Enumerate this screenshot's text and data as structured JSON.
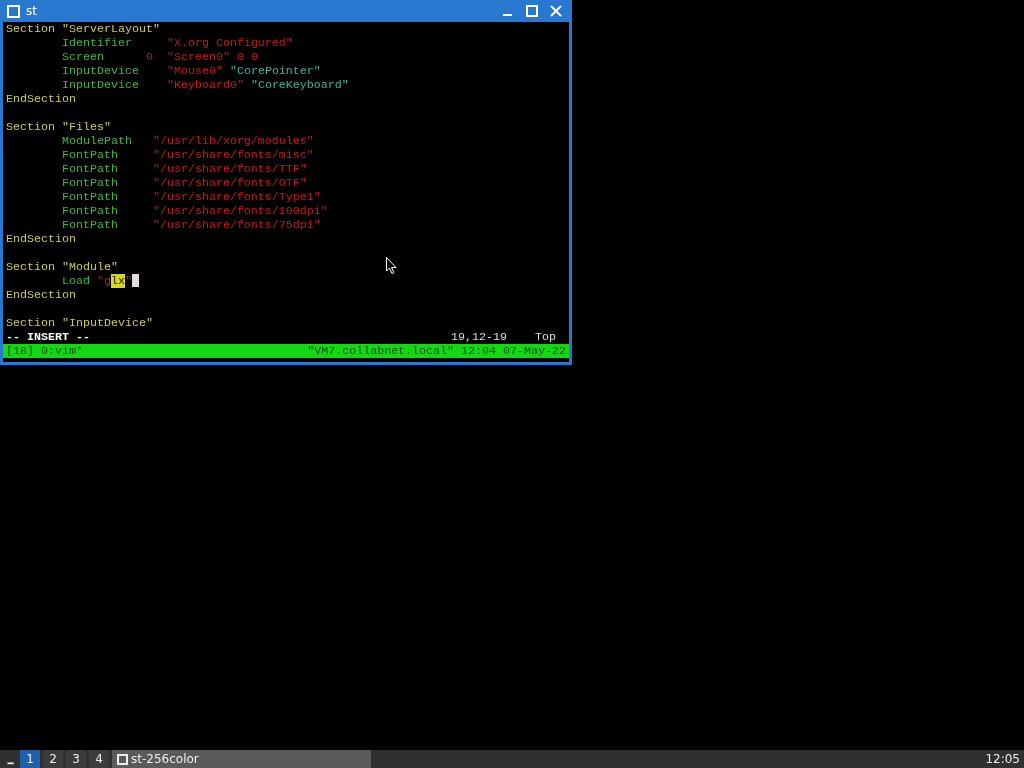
{
  "window": {
    "title": "st",
    "active": true
  },
  "terminal": {
    "lines": [
      {
        "kind": "code",
        "indented": false,
        "segments": [
          {
            "text": "Section ",
            "kind": "keyword"
          },
          {
            "text": "\"ServerLayout\"",
            "kind": "keyword"
          }
        ]
      },
      {
        "kind": "code",
        "indented": true,
        "segments": [
          {
            "text": "Identifier     ",
            "kind": "option"
          },
          {
            "text": "\"X.org Configured\"",
            "kind": "string"
          }
        ]
      },
      {
        "kind": "code",
        "indented": true,
        "segments": [
          {
            "text": "Screen      ",
            "kind": "option"
          },
          {
            "text": "0  ",
            "kind": "string"
          },
          {
            "text": "\"Screen0\" 0 0",
            "kind": "string"
          }
        ]
      },
      {
        "kind": "code",
        "indented": true,
        "segments": [
          {
            "text": "InputDevice    ",
            "kind": "option"
          },
          {
            "text": "\"Mouse0\" ",
            "kind": "string"
          },
          {
            "text": "\"CorePointer\"",
            "kind": "special"
          }
        ]
      },
      {
        "kind": "code",
        "indented": true,
        "segments": [
          {
            "text": "InputDevice    ",
            "kind": "option"
          },
          {
            "text": "\"Keyboard0\" ",
            "kind": "string"
          },
          {
            "text": "\"CoreKeyboard\"",
            "kind": "special"
          }
        ]
      },
      {
        "kind": "code",
        "indented": false,
        "segments": [
          {
            "text": "EndSection",
            "kind": "keyword"
          }
        ]
      },
      {
        "kind": "blank"
      },
      {
        "kind": "code",
        "indented": false,
        "segments": [
          {
            "text": "Section ",
            "kind": "keyword"
          },
          {
            "text": "\"Files\"",
            "kind": "keyword"
          }
        ]
      },
      {
        "kind": "code",
        "indented": true,
        "segments": [
          {
            "text": "ModulePath   ",
            "kind": "option"
          },
          {
            "text": "\"/usr/lib/xorg/modules\"",
            "kind": "string"
          }
        ]
      },
      {
        "kind": "code",
        "indented": true,
        "segments": [
          {
            "text": "FontPath     ",
            "kind": "option"
          },
          {
            "text": "\"/usr/share/fonts/misc\"",
            "kind": "string"
          }
        ]
      },
      {
        "kind": "code",
        "indented": true,
        "segments": [
          {
            "text": "FontPath     ",
            "kind": "option"
          },
          {
            "text": "\"/usr/share/fonts/TTF\"",
            "kind": "string"
          }
        ]
      },
      {
        "kind": "code",
        "indented": true,
        "segments": [
          {
            "text": "FontPath     ",
            "kind": "option"
          },
          {
            "text": "\"/usr/share/fonts/OTF\"",
            "kind": "string"
          }
        ]
      },
      {
        "kind": "code",
        "indented": true,
        "segments": [
          {
            "text": "FontPath     ",
            "kind": "option"
          },
          {
            "text": "\"/usr/share/fonts/Type1\"",
            "kind": "string"
          }
        ]
      },
      {
        "kind": "code",
        "indented": true,
        "segments": [
          {
            "text": "FontPath     ",
            "kind": "option"
          },
          {
            "text": "\"/usr/share/fonts/100dpi\"",
            "kind": "string"
          }
        ]
      },
      {
        "kind": "code",
        "indented": true,
        "segments": [
          {
            "text": "FontPath     ",
            "kind": "option"
          },
          {
            "text": "\"/usr/share/fonts/75dpi\"",
            "kind": "string"
          }
        ]
      },
      {
        "kind": "code",
        "indented": false,
        "segments": [
          {
            "text": "EndSection",
            "kind": "keyword"
          }
        ]
      },
      {
        "kind": "blank"
      },
      {
        "kind": "code",
        "indented": false,
        "segments": [
          {
            "text": "Section ",
            "kind": "keyword"
          },
          {
            "text": "\"Module\"",
            "kind": "keyword"
          }
        ]
      },
      {
        "kind": "code",
        "indented": true,
        "cursor": true,
        "segments": [
          {
            "text": "Load ",
            "kind": "option"
          },
          {
            "text": "\"g",
            "kind": "string"
          },
          {
            "text": "lx",
            "kind": "match"
          },
          {
            "text": "\"",
            "kind": "string"
          }
        ]
      },
      {
        "kind": "code",
        "indented": false,
        "segments": [
          {
            "text": "EndSection",
            "kind": "keyword"
          }
        ]
      },
      {
        "kind": "blank"
      },
      {
        "kind": "code",
        "indented": false,
        "segments": [
          {
            "text": "Section ",
            "kind": "keyword"
          },
          {
            "text": "\"InputDevice\"",
            "kind": "keyword"
          }
        ]
      }
    ],
    "mode": "-- INSERT --",
    "position": "19,12-19",
    "scroll": "Top",
    "tmux": {
      "left": "[18] 0:vim*",
      "right": "\"VM7.collabnet.local\" 12:04 07-May-22"
    }
  },
  "taskbar": {
    "workspaces": [
      {
        "label": "1",
        "selected": true
      },
      {
        "label": "2",
        "selected": false
      },
      {
        "label": "3",
        "selected": false
      },
      {
        "label": "4",
        "selected": false
      }
    ],
    "tasks": [
      {
        "label": "st-256color",
        "selected": true
      }
    ],
    "clock": "12:05"
  }
}
